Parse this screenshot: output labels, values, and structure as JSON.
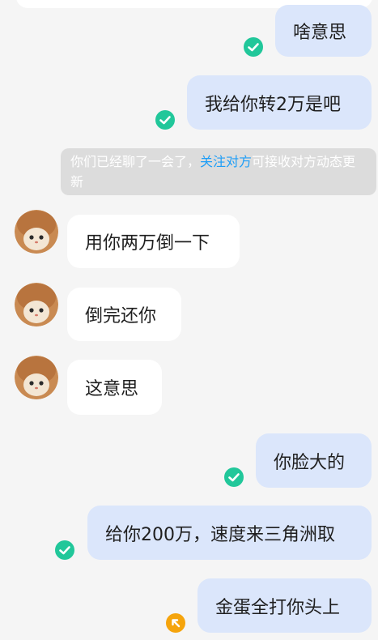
{
  "messages": {
    "m1": "啥意思",
    "m2": "我给你转2万是吧",
    "m3": "用你两万倒一下",
    "m4": "倒完还你",
    "m5": "这意思",
    "m6": "你脸大的",
    "m7": "给你200万，速度来三角洲取",
    "m8": "金蛋全打你头上"
  },
  "notice": {
    "prefix": "你们已经聊了一会了，",
    "link": "关注对方",
    "suffix": "可接收对方动态更新"
  },
  "colors": {
    "my_bubble": "#dbe6fb",
    "their_bubble": "#ffffff",
    "read_check": "#21c79a",
    "pending": "#f5a40c",
    "link": "#1e9ef7"
  },
  "icons": {
    "read": "check-circle-icon",
    "sending": "arrow-up-left-icon",
    "avatar": "cat-avatar"
  }
}
